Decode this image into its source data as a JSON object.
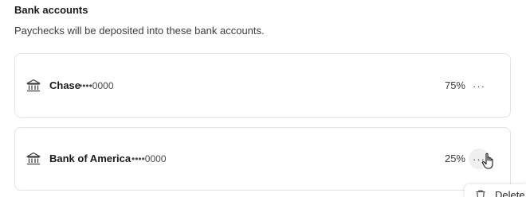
{
  "section": {
    "title": "Bank accounts",
    "subtitle": "Paychecks will be deposited into these bank accounts."
  },
  "accounts": [
    {
      "name": "Chase",
      "masked_number": "••••0000",
      "percent": "75%",
      "icon": "bank-icon",
      "more": "···"
    },
    {
      "name": "Bank of America",
      "masked_number": "••••0000",
      "percent": "25%",
      "icon": "bank-icon",
      "more": "···"
    }
  ],
  "menu": {
    "delete_label": "Delete",
    "delete_icon": "trash-icon"
  }
}
